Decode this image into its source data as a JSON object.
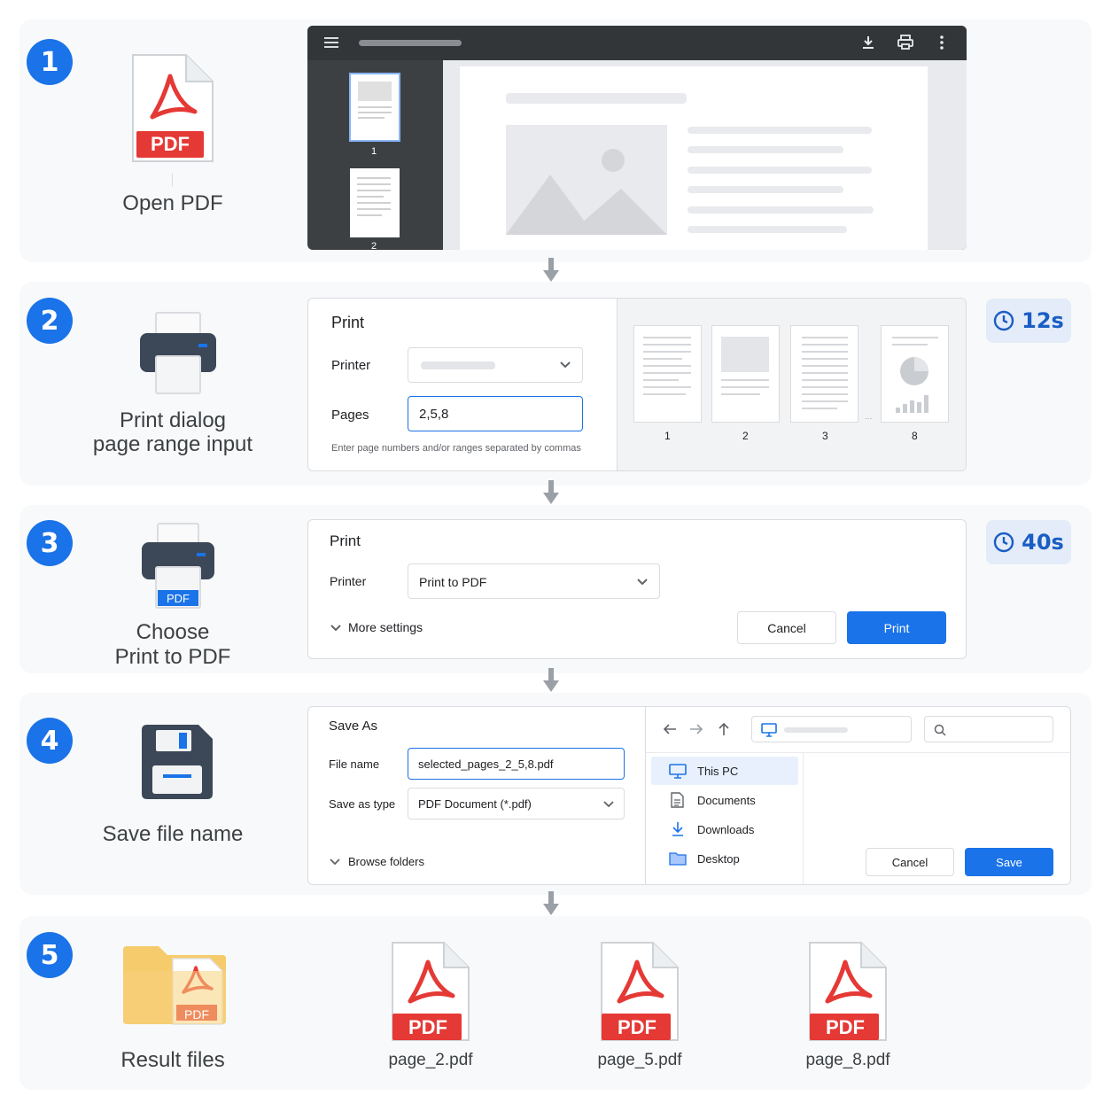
{
  "steps": [
    {
      "number": "1",
      "label": "Open PDF"
    },
    {
      "number": "2",
      "label_line1": "Print dialog",
      "label_line2": "page range input"
    },
    {
      "number": "3",
      "label_line1": "Choose",
      "label_line2": "Print to PDF"
    },
    {
      "number": "4",
      "label": "Save file name"
    },
    {
      "number": "5",
      "label": "Result files"
    }
  ],
  "pdf_badge": "PDF",
  "viewer": {
    "thumbnails": [
      "1",
      "2"
    ]
  },
  "print_dialog_1": {
    "title": "Print",
    "printer_label": "Printer",
    "pages_label": "Pages",
    "pages_value": "2,5,8",
    "hint": "Enter page numbers and/or ranges separated by commas",
    "preview_pages": [
      "1",
      "2",
      "3",
      "8"
    ],
    "ellipsis": "..."
  },
  "timer_1": "12s",
  "print_dialog_2": {
    "title": "Print",
    "printer_label": "Printer",
    "printer_value": "Print to PDF",
    "more_settings": "More settings",
    "cancel": "Cancel",
    "print": "Print"
  },
  "timer_2": "40s",
  "save_dialog": {
    "title": "Save As",
    "file_name_label": "File name",
    "file_name_value": "selected_pages_2_5,8.pdf",
    "save_type_label": "Save as type",
    "save_type_value": "PDF Document (*.pdf)",
    "browse_folders": "Browse folders",
    "nav_items": [
      "This PC",
      "Documents",
      "Downloads",
      "Desktop"
    ],
    "cancel": "Cancel",
    "save": "Save"
  },
  "results": {
    "folder_badge": "PDF",
    "files": [
      "page_2.pdf",
      "page_5.pdf",
      "page_8.pdf"
    ]
  },
  "colors": {
    "accent": "#1a73e8",
    "pdf_red": "#e53935",
    "viewer_dark": "#3c4043"
  }
}
